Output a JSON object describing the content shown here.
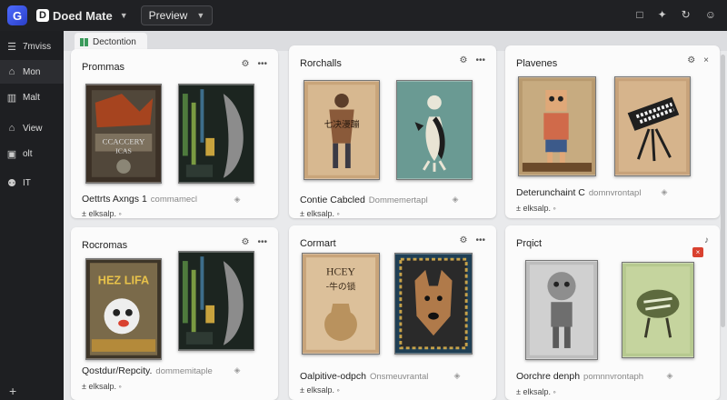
{
  "app": {
    "logo_letter": "G",
    "mark": "D",
    "name": "Doed Mate",
    "preview_label": "Preview"
  },
  "top_icons": [
    "square-icon",
    "bell-icon",
    "refresh-icon",
    "user-icon"
  ],
  "top_icon_glyphs": [
    "□",
    "✦",
    "↻",
    "☺"
  ],
  "sidebar": {
    "items": [
      {
        "label": "7mviss",
        "icon": "menu-icon",
        "glyph": "☰"
      },
      {
        "label": "Mon",
        "icon": "home-icon",
        "glyph": "⌂"
      },
      {
        "label": "Malt",
        "icon": "grid-icon",
        "glyph": "▥"
      },
      {
        "label": "View",
        "icon": "view-icon",
        "glyph": "⌂"
      },
      {
        "label": "olt",
        "icon": "doc-icon",
        "glyph": "▣"
      },
      {
        "label": "IT",
        "icon": "person-icon",
        "glyph": "⚉"
      }
    ],
    "plus": "+"
  },
  "tab": {
    "label": "Dectontion"
  },
  "toolbar": {
    "settings_glyph": "⚙",
    "search_glyph": "⚲"
  },
  "cards": [
    {
      "title": "Prommas",
      "caption": "Oettrts Axngs 1",
      "caption_sub": "commamecl",
      "meta": "± elksalp. ◦",
      "art_text": "CCACCERY ICAS",
      "art_letter": "C"
    },
    {
      "title": "Rorchalls",
      "caption": "Contie Cabcled",
      "caption_sub": "Dommemertapl",
      "meta": "± elksalp. ◦",
      "art_text": "七决漫蹦",
      "art_letter": "R"
    },
    {
      "title": "Plavenes",
      "caption": "Deterunchaint C",
      "caption_sub": "domnvrontapl",
      "meta": "± elksalp. ◦",
      "art_text": "",
      "art_letter": "P"
    },
    {
      "title": "Rocromas",
      "caption": "Qostdur/Repcity.",
      "caption_sub": "dommemitaple",
      "meta": "± elksalp. ◦",
      "art_text": "HEZ LIFA",
      "art_letter": "R"
    },
    {
      "title": "Cormart",
      "caption": "Oalpitive-odpch",
      "caption_sub": "Onsmeuvrantal",
      "meta": "± elksalp. ◦",
      "art_text": "HCEY -牛の锁",
      "art_letter": "C"
    },
    {
      "title": "Prqict",
      "caption": "Oorchre denph",
      "caption_sub": "pomnnvrontaph",
      "meta": "± elksalp. ◦",
      "art_text": "",
      "art_letter": "P",
      "badge": "×"
    }
  ],
  "colors": {
    "accent": "#3d5afe",
    "badge_red": "#d9412f",
    "topbar": "#202124"
  }
}
